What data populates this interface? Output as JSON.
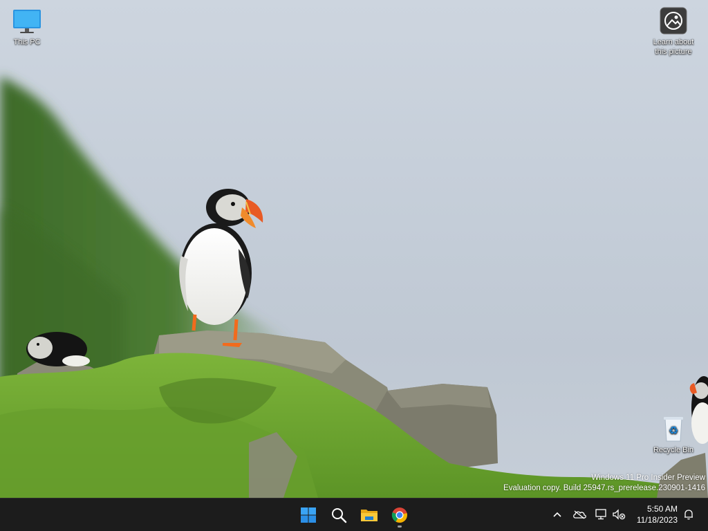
{
  "desktop": {
    "icons": [
      {
        "label": "This PC",
        "icon": "monitor-icon"
      },
      {
        "label": "Learn about this picture",
        "line1": "Learn about",
        "line2": "this picture",
        "icon": "camera-icon"
      },
      {
        "label": "Recycle Bin",
        "icon": "recycle-bin-icon"
      }
    ],
    "watermark": {
      "line1": "Windows 11 Pro Insider Preview",
      "line2": "Evaluation copy. Build 25947.rs_prerelease.230901-1416"
    }
  },
  "taskbar": {
    "apps": [
      {
        "name": "Start",
        "icon": "windows-logo-icon"
      },
      {
        "name": "Search",
        "icon": "search-icon"
      },
      {
        "name": "File Explorer",
        "icon": "folder-icon"
      },
      {
        "name": "Google Chrome",
        "icon": "chrome-icon",
        "running": true
      }
    ],
    "tray": {
      "icons": [
        "chevron-up-icon",
        "cloud-offline-icon",
        "network-icon",
        "speaker-muted-icon"
      ],
      "clock": {
        "time": "5:50 AM",
        "date": "11/18/2023"
      },
      "notification_icon": "bell-icon"
    }
  },
  "colors": {
    "taskbar_bg": "#1c1c1c",
    "accent": "#0078d4"
  }
}
